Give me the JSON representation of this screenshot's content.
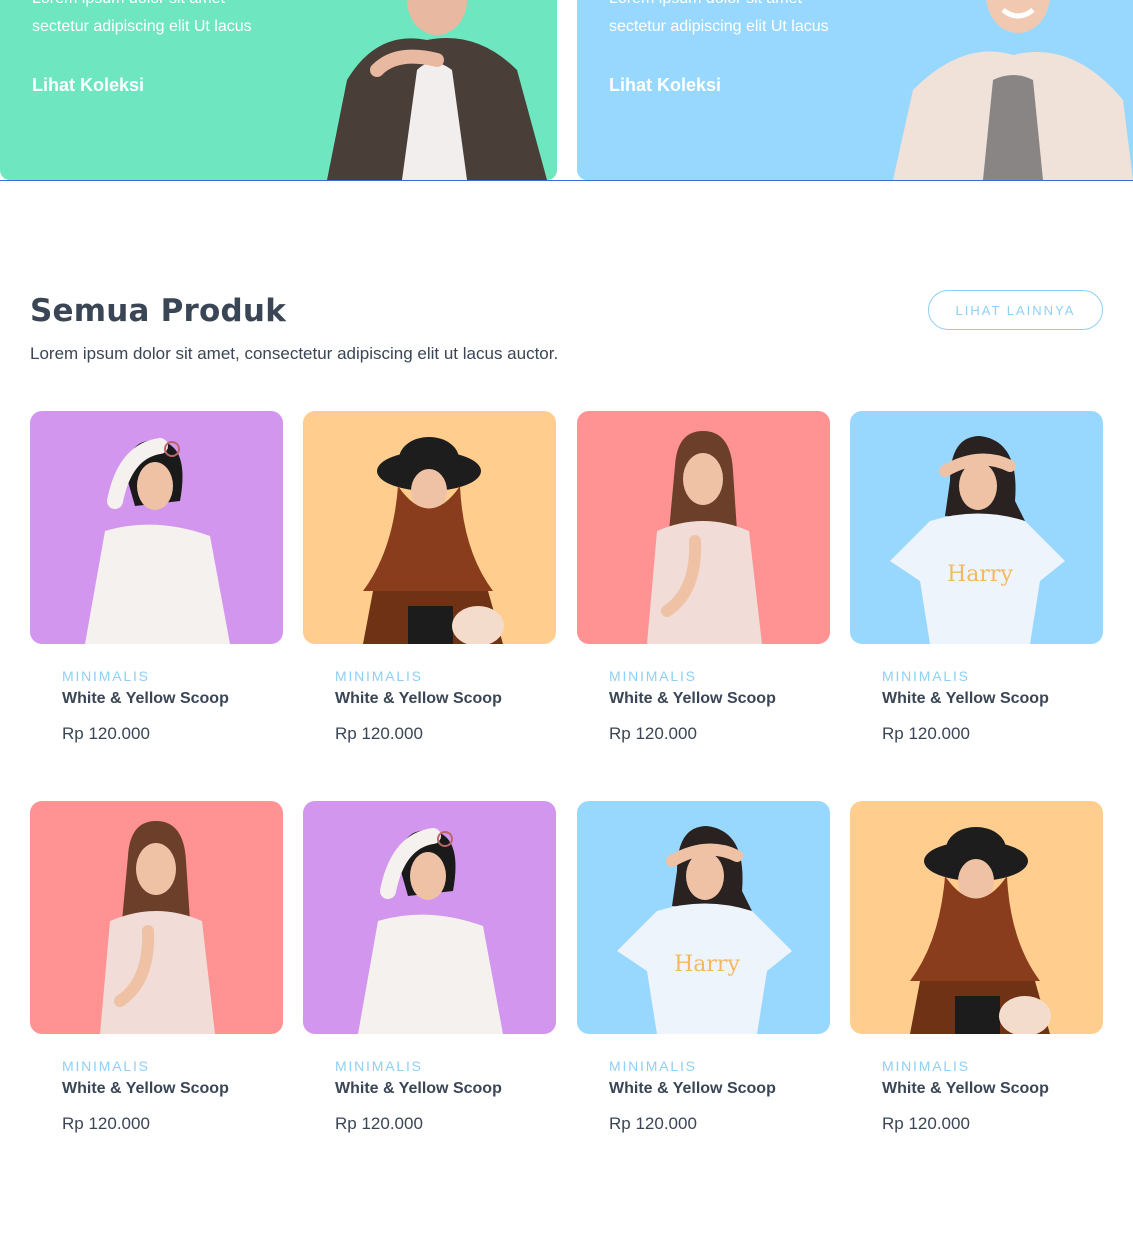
{
  "banners": [
    {
      "line1": "Lorem ipsum dolor sit amet",
      "line2": "sectetur adipiscing elit Ut lacus",
      "cta": "Lihat Koleksi",
      "bg": "#6ee7c0"
    },
    {
      "line1": "Lorem ipsum dolor sit amet",
      "line2": "sectetur adipiscing elit Ut lacus",
      "cta": "Lihat Koleksi",
      "bg": "#98d8ff"
    }
  ],
  "section": {
    "title": "Semua Produk",
    "description": "Lorem ipsum dolor sit amet, consectetur adipiscing elit ut lacus auctor.",
    "more_label": "LIHAT LAINNYA"
  },
  "products": [
    {
      "category": "MINIMALIS",
      "name": "White & Yellow Scoop",
      "price": "Rp 120.000",
      "bg": "#d396ee",
      "model": "short-hair"
    },
    {
      "category": "MINIMALIS",
      "name": "White & Yellow Scoop",
      "price": "Rp 120.000",
      "bg": "#ffce8f",
      "model": "hijab-hat"
    },
    {
      "category": "MINIMALIS",
      "name": "White & Yellow Scoop",
      "price": "Rp 120.000",
      "bg": "#ff9292",
      "model": "long-hair"
    },
    {
      "category": "MINIMALIS",
      "name": "White & Yellow Scoop",
      "price": "Rp 120.000",
      "bg": "#98d8ff",
      "model": "tee"
    },
    {
      "category": "MINIMALIS",
      "name": "White & Yellow Scoop",
      "price": "Rp 120.000",
      "bg": "#ff9292",
      "model": "long-hair"
    },
    {
      "category": "MINIMALIS",
      "name": "White & Yellow Scoop",
      "price": "Rp 120.000",
      "bg": "#d396ee",
      "model": "short-hair"
    },
    {
      "category": "MINIMALIS",
      "name": "White & Yellow Scoop",
      "price": "Rp 120.000",
      "bg": "#98d8ff",
      "model": "tee"
    },
    {
      "category": "MINIMALIS",
      "name": "White & Yellow Scoop",
      "price": "Rp 120.000",
      "bg": "#ffce8f",
      "model": "hijab-hat"
    }
  ]
}
